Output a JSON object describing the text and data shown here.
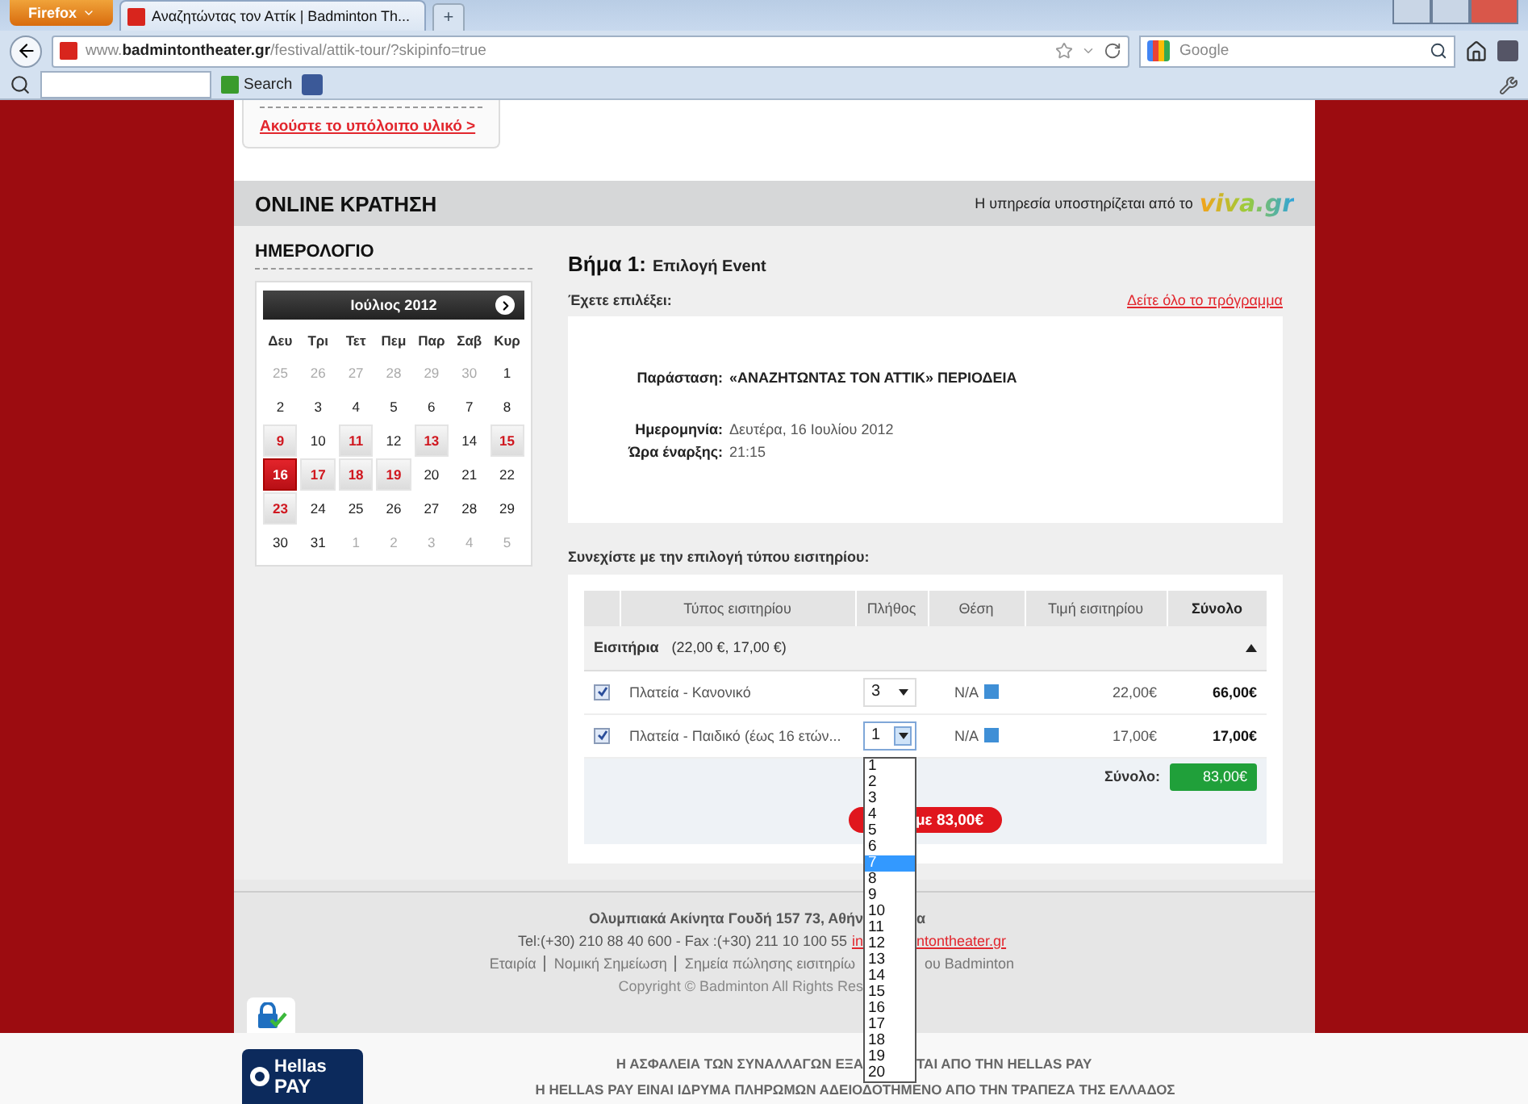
{
  "browser": {
    "menu_button": "Firefox",
    "tab_title": "Αναζητώντας τον Αττίκ | Badminton Th...",
    "new_tab": "+",
    "url": "www.**badmintontheater.gr**/festival/attik-tour/?skipinfo=true",
    "search_placeholder": "Google",
    "toolbar_search": "Search"
  },
  "media_card": {
    "link": "Ακούστε το υπόλοιπο υλικό >"
  },
  "booking_bar": {
    "title": "ONLINE ΚΡΑΤΗΣΗ",
    "powered_by": "Η υπηρεσία υποστηρίζεται από το",
    "logo": "viva.gr"
  },
  "calendar": {
    "heading": "ΗΜΕΡΟΛΟΓΙΟ",
    "month": "Ιούλιος 2012",
    "weekdays": [
      "Δευ",
      "Τρι",
      "Τετ",
      "Πεμ",
      "Παρ",
      "Σαβ",
      "Κυρ"
    ],
    "days": [
      {
        "label": "25",
        "kind": "muted",
        "selected": false
      },
      {
        "label": "26",
        "kind": "muted",
        "selected": false
      },
      {
        "label": "27",
        "kind": "muted",
        "selected": false
      },
      {
        "label": "28",
        "kind": "muted",
        "selected": false
      },
      {
        "label": "29",
        "kind": "muted",
        "selected": false
      },
      {
        "label": "30",
        "kind": "muted",
        "selected": false
      },
      {
        "label": "1",
        "kind": "plain",
        "selected": false
      },
      {
        "label": "2",
        "kind": "plain",
        "selected": false
      },
      {
        "label": "3",
        "kind": "plain",
        "selected": false
      },
      {
        "label": "4",
        "kind": "plain",
        "selected": false
      },
      {
        "label": "5",
        "kind": "plain",
        "selected": false
      },
      {
        "label": "6",
        "kind": "plain",
        "selected": false
      },
      {
        "label": "7",
        "kind": "plain",
        "selected": false
      },
      {
        "label": "8",
        "kind": "plain",
        "selected": false
      },
      {
        "label": "9",
        "kind": "event",
        "selected": false
      },
      {
        "label": "10",
        "kind": "plain",
        "selected": false
      },
      {
        "label": "11",
        "kind": "event",
        "selected": false
      },
      {
        "label": "12",
        "kind": "plain",
        "selected": false
      },
      {
        "label": "13",
        "kind": "event",
        "selected": false
      },
      {
        "label": "14",
        "kind": "plain",
        "selected": false
      },
      {
        "label": "15",
        "kind": "event",
        "selected": false
      },
      {
        "label": "16",
        "kind": "event",
        "selected": true
      },
      {
        "label": "17",
        "kind": "event",
        "selected": false
      },
      {
        "label": "18",
        "kind": "event",
        "selected": false
      },
      {
        "label": "19",
        "kind": "event",
        "selected": false
      },
      {
        "label": "20",
        "kind": "plain",
        "selected": false
      },
      {
        "label": "21",
        "kind": "plain",
        "selected": false
      },
      {
        "label": "22",
        "kind": "plain",
        "selected": false
      },
      {
        "label": "23",
        "kind": "event",
        "selected": false
      },
      {
        "label": "24",
        "kind": "plain",
        "selected": false
      },
      {
        "label": "25",
        "kind": "plain",
        "selected": false
      },
      {
        "label": "26",
        "kind": "plain",
        "selected": false
      },
      {
        "label": "27",
        "kind": "plain",
        "selected": false
      },
      {
        "label": "28",
        "kind": "plain",
        "selected": false
      },
      {
        "label": "29",
        "kind": "plain",
        "selected": false
      },
      {
        "label": "30",
        "kind": "plain",
        "selected": false
      },
      {
        "label": "31",
        "kind": "plain",
        "selected": false
      },
      {
        "label": "1",
        "kind": "muted",
        "selected": false
      },
      {
        "label": "2",
        "kind": "muted",
        "selected": false
      },
      {
        "label": "3",
        "kind": "muted",
        "selected": false
      },
      {
        "label": "4",
        "kind": "muted",
        "selected": false
      },
      {
        "label": "5",
        "kind": "muted",
        "selected": false
      }
    ]
  },
  "step": {
    "number": "Βήμα 1:",
    "title": "Επιλογή Event",
    "chosen_label": "Έχετε επιλέξει:",
    "program_link": "Δείτε όλο το πρόγραμμα",
    "details": [
      {
        "label": "Παράσταση:",
        "value": "«ΑΝΑΖΗΤΩΝΤΑΣ ΤΟΝ ΑΤΤΙΚ» ΠΕΡΙΟΔΕΙΑ",
        "kind": "title"
      },
      {
        "label": "Ημερομηνία:",
        "value": "Δευτέρα, 16 Ιουλίου 2012",
        "kind": "date"
      },
      {
        "label": "Ώρα έναρξης:",
        "value": "21:15",
        "kind": "time"
      }
    ]
  },
  "tickets": {
    "prompt": "Συνεχίστε με την επιλογή τύπου εισιτηρίου:",
    "columns": [
      "Τύπος εισιτηρίου",
      "Πλήθος",
      "Θέση",
      "Τιμή εισιτηρίου",
      "Σύνολο"
    ],
    "group": {
      "label": "Εισιτήρια",
      "prices": "(22,00 €, 17,00 €)",
      "expanded": true
    },
    "rows": [
      {
        "checked": true,
        "type": "Πλατεία - Κανονικό",
        "quantity": "3",
        "open": false,
        "seat": "N/A",
        "price": "22,00€",
        "total": "66,00€"
      },
      {
        "checked": true,
        "type": "Πλατεία - Παιδικό (έως 16 ετών...",
        "quantity": "1",
        "open": true,
        "seat": "N/A",
        "price": "17,00€",
        "total": "17,00€"
      }
    ],
    "total_label": "Σύνολο:",
    "total": "83,00€",
    "book_button": "με 83,00€",
    "quantity_options": [
      {
        "label": "1",
        "selected": false
      },
      {
        "label": "2",
        "selected": false
      },
      {
        "label": "3",
        "selected": false
      },
      {
        "label": "4",
        "selected": false
      },
      {
        "label": "5",
        "selected": false
      },
      {
        "label": "6",
        "selected": false
      },
      {
        "label": "7",
        "selected": true
      },
      {
        "label": "8",
        "selected": false
      },
      {
        "label": "9",
        "selected": false
      },
      {
        "label": "10",
        "selected": false
      },
      {
        "label": "11",
        "selected": false
      },
      {
        "label": "12",
        "selected": false
      },
      {
        "label": "13",
        "selected": false
      },
      {
        "label": "14",
        "selected": false
      },
      {
        "label": "15",
        "selected": false
      },
      {
        "label": "16",
        "selected": false
      },
      {
        "label": "17",
        "selected": false
      },
      {
        "label": "18",
        "selected": false
      },
      {
        "label": "19",
        "selected": false
      },
      {
        "label": "20",
        "selected": false
      }
    ]
  },
  "footer": {
    "lines": [
      {
        "left": [
          {
            "text": "Ολυμπιακά Ακίνητα Γουδή 157 73, Αθήν",
            "kind": "strong"
          }
        ],
        "right": [
          {
            "text": "α",
            "kind": "strong"
          }
        ]
      },
      {
        "left": [
          {
            "text": "Tel:(+30) 210 88 40 600 - Fax :(+30) 211 10 100 55",
            "kind": "text"
          },
          {
            "text": "in",
            "kind": "link"
          }
        ],
        "right": [
          {
            "text": "ntontheater.gr",
            "kind": "link"
          }
        ]
      },
      {
        "left": [
          {
            "text": "Εταιρία",
            "kind": "nav"
          },
          {
            "text": "Νομική Σημείωση",
            "kind": "nav"
          },
          {
            "text": "Σημεία πώλησης εισιτηρίω",
            "kind": "nav"
          }
        ],
        "right": [
          {
            "text": "ου Badminton",
            "kind": "nav"
          }
        ]
      },
      {
        "left": [
          {
            "text": "Copyright © Badminton All Rights Res",
            "kind": "muted"
          }
        ]
      }
    ]
  },
  "hellas_pay": {
    "logo_top": "Hellas",
    "logo_bottom": "PAY",
    "lines": [
      {
        "kind": "split",
        "left": "Η ΑΣΦΑΛΕΙΑ ΤΩΝ ΣΥΝΑΛΛΑΓΩΝ ΕΞΑ",
        "right": "ΤΑΙ ΑΠΟ ΤΗΝ HELLAS PAY"
      },
      {
        "kind": "full",
        "left": "Η HELLAS PAY ΕΙΝΑΙ ΙΔΡΥΜΑ ΠΛΗΡΩΜΩΝ ΑΔΕΙΟΔΟΤΗΜΕΝΟ ΑΠΟ ΤΗΝ ΤΡΑΠΕΖΑ ΤΗΣ ΕΛΛΑΔΟΣ"
      }
    ]
  }
}
